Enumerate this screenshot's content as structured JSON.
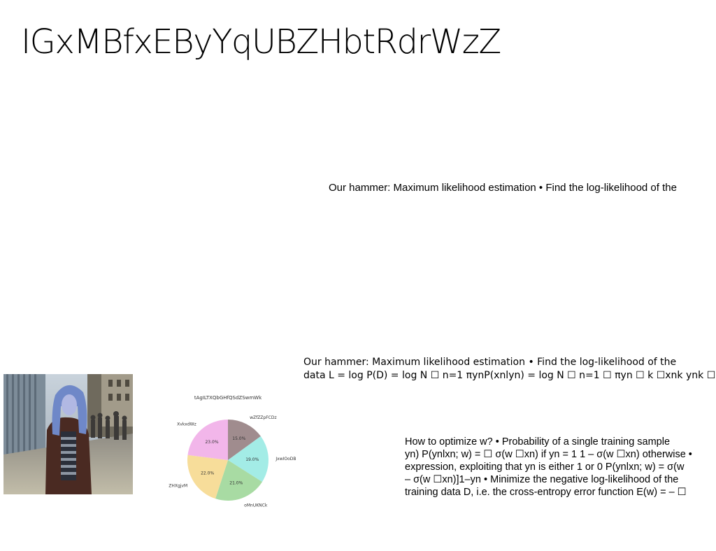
{
  "slide": {
    "title": "IGxMBfxEByYqUBZHbtRdrWzZ"
  },
  "text_1": "Our hammer: Maximum likelihood estimation • Find the log-likelihood of the",
  "text_2": {
    "line_1": "Our hammer: Maximum likelihood estimation • Find the log-likelihood of the",
    "line_2": "data L = log P(D) = log N ☐ n=1 πynP(xnlyn) = log N ☐ n=1 ☐ πyn ☐ k ☐xnk ynk ☐"
  },
  "text_3": {
    "line_1": "How to optimize w? • Probability of a single training sample",
    "line_2": "yn) P(ynlxn; w) = ☐ σ(w ☐xn) if yn = 1 1 – σ(w ☐xn) otherwise •",
    "line_3": "expression, exploiting that yn is either 1 or 0 P(ynlxn; w) = σ(w",
    "line_4": "– σ(w ☐xn)]1–yn • Minimize the negative log-likelihood of the",
    "line_5": "training data D, i.e. the cross-entropy error function E(w) = – ☐"
  },
  "chart_data": {
    "type": "pie",
    "title": "tAgILTXQbGHfQSdZSwmWk",
    "categories": [
      "wZfZZpFCDz",
      "JxwIOoDB",
      "oMnUKNCk",
      "ZHXgjvM",
      "XvkxdWz"
    ],
    "values": [
      15.0,
      19.0,
      21.0,
      22.0,
      23.0
    ],
    "labels": [
      "15.0%",
      "19.0%",
      "21.0%",
      "22.0%",
      "23.0%"
    ],
    "colors": [
      "#a08c8e",
      "#a3ece6",
      "#a8dba3",
      "#f7dd9a",
      "#f2b6ea"
    ],
    "start_angle": 90,
    "direction": "clockwise"
  }
}
